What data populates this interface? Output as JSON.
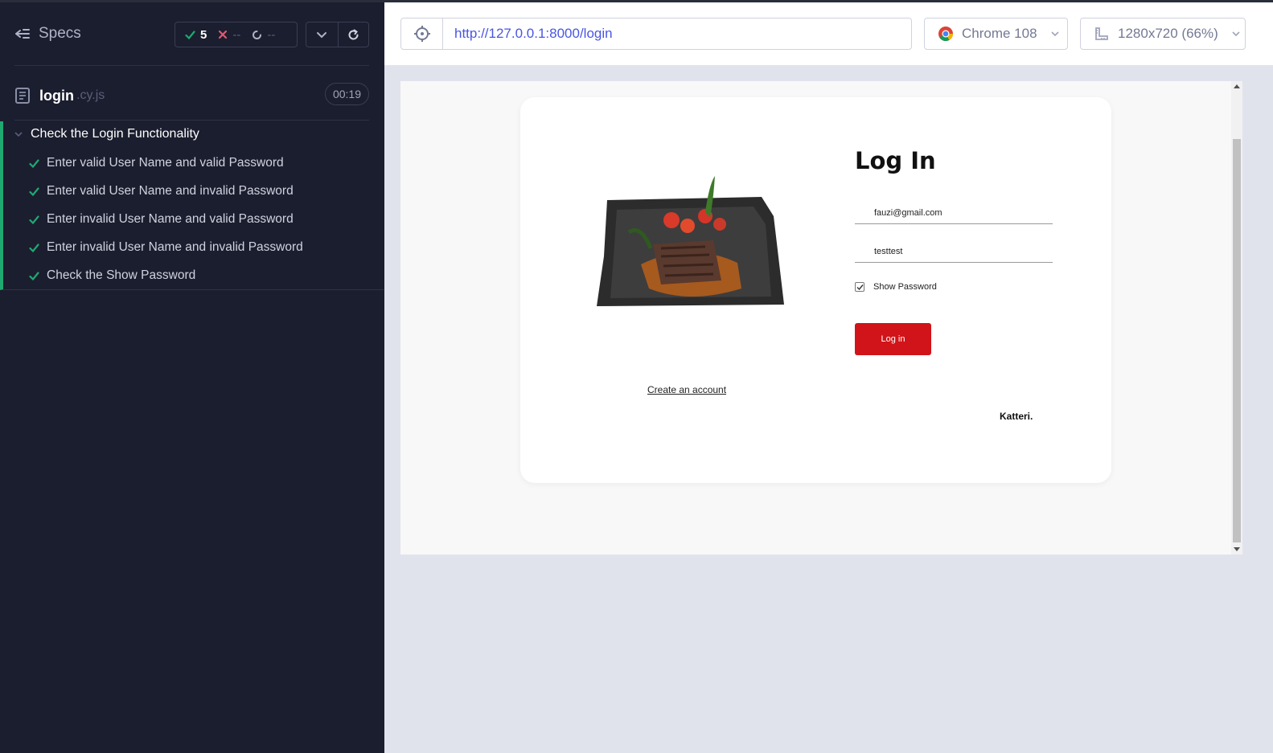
{
  "reporter": {
    "specs_label": "Specs",
    "stats": {
      "passed": "5",
      "failed": "--",
      "pending": "--"
    },
    "spec_file": {
      "name": "login",
      "ext": ".cy.js",
      "duration": "00:19"
    },
    "suite": {
      "title": "Check the Login Functionality",
      "tests": [
        {
          "label": "Enter valid User Name and valid Password",
          "status": "passed"
        },
        {
          "label": "Enter valid User Name and invalid Password",
          "status": "passed"
        },
        {
          "label": "Enter invalid User Name and valid Password",
          "status": "passed"
        },
        {
          "label": "Enter invalid User Name and invalid Password",
          "status": "passed"
        },
        {
          "label": "Check the Show Password",
          "status": "passed"
        }
      ]
    }
  },
  "toolbar": {
    "url": "http://127.0.0.1:8000/login",
    "browser": "Chrome 108",
    "viewport": "1280x720 (66%)"
  },
  "app": {
    "title": "Log In",
    "email_value": "fauzi@gmail.com",
    "password_value": "testtest",
    "show_password_label": "Show Password",
    "show_password_checked": true,
    "login_button": "Log in",
    "create_account_link": "Create an account",
    "brand": "Katteri."
  },
  "colors": {
    "reporter_bg": "#1b1e2e",
    "pass_green": "#1fa971",
    "fail_red": "#e45770",
    "url_blue": "#4956e3",
    "login_red": "#d01419"
  }
}
